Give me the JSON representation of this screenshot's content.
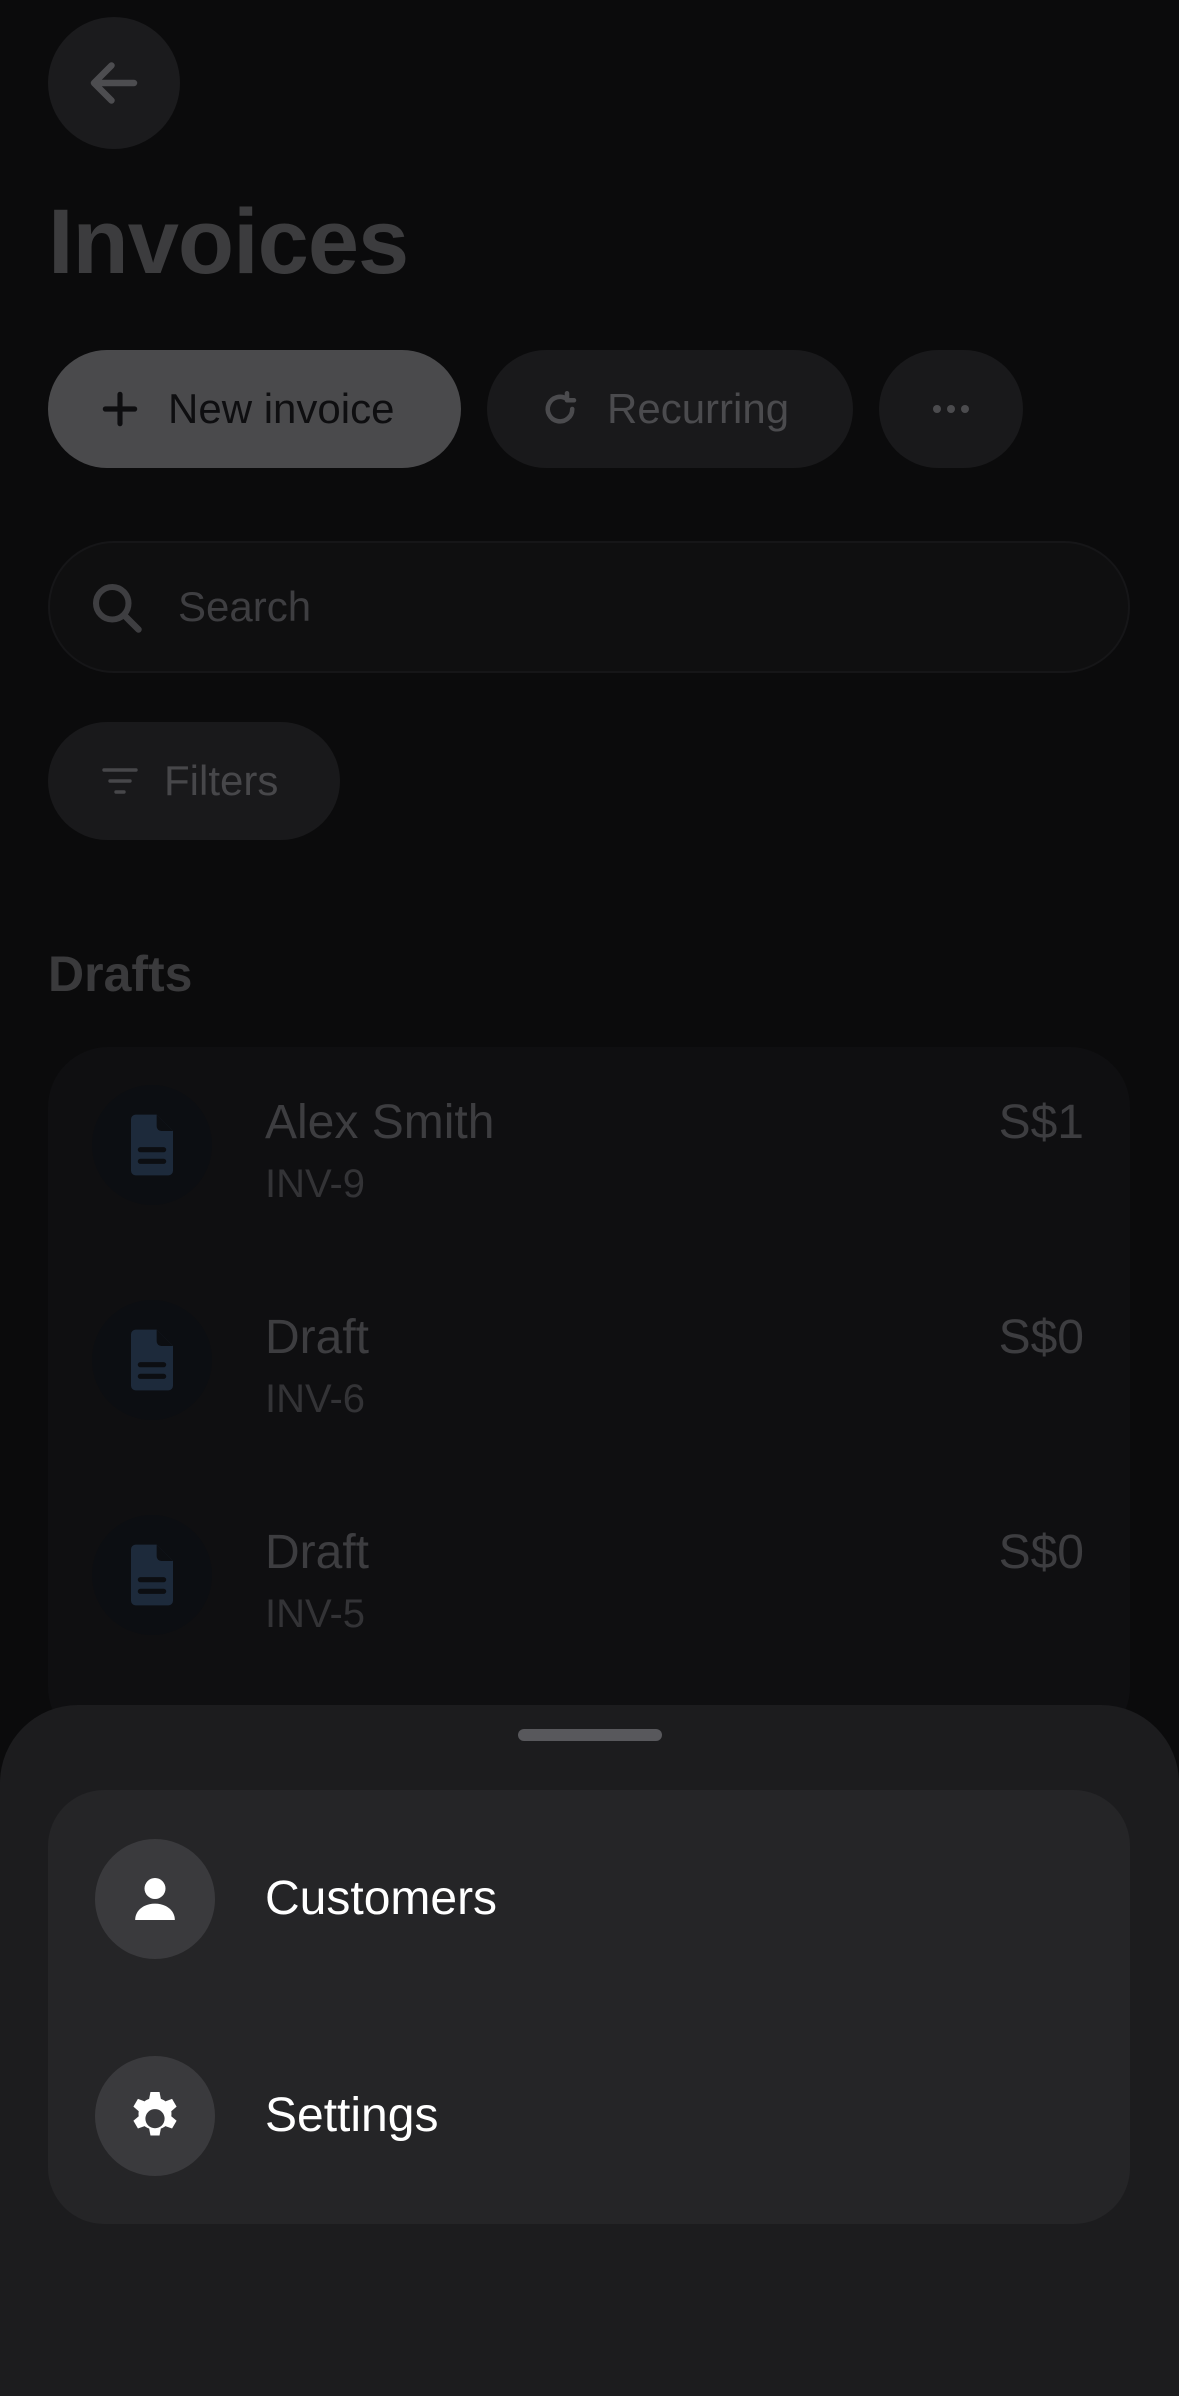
{
  "header": {
    "title": "Invoices"
  },
  "actions": {
    "new_invoice": "New invoice",
    "recurring": "Recurring"
  },
  "search": {
    "placeholder": "Search"
  },
  "filters": {
    "label": "Filters"
  },
  "drafts": {
    "section_title": "Drafts",
    "rows": [
      {
        "name": "Alex Smith",
        "number": "INV-9",
        "amount": "S$1"
      },
      {
        "name": "Draft",
        "number": "INV-6",
        "amount": "S$0"
      },
      {
        "name": "Draft",
        "number": "INV-5",
        "amount": "S$0"
      }
    ]
  },
  "sheet": {
    "items": [
      {
        "label": "Customers",
        "icon": "person-icon"
      },
      {
        "label": "Settings",
        "icon": "gear-icon"
      }
    ]
  },
  "colors": {
    "sheet_bg": "#1c1c1e",
    "menu_card_bg": "#252527",
    "doc_icon": "#1d2a3b"
  }
}
